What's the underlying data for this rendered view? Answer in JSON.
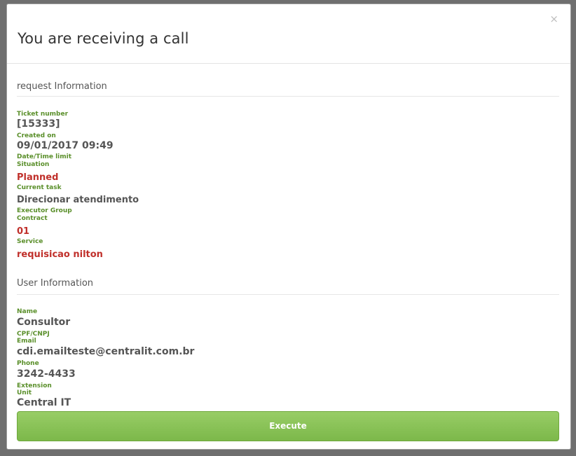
{
  "modal": {
    "title": "You are receiving a call",
    "close_label": "×"
  },
  "request_info": {
    "heading": "request Information",
    "ticket_number_label": "Ticket number",
    "ticket_number": "[15333]",
    "created_on_label": "Created on",
    "created_on": "09/01/2017 09:49",
    "date_time_limit_label": "Date/Time limit",
    "situation_label": "Situation",
    "situation": "Planned",
    "current_task_label": "Current task",
    "current_task": "Direcionar atendimento",
    "executor_group_label": "Executor Group",
    "contract_label": "Contract",
    "contract": "01",
    "service_label": "Service",
    "service": "requisicao nilton"
  },
  "user_info": {
    "heading": "User Information",
    "name_label": "Name",
    "name": "Consultor",
    "cpf_label": "CPF/CNPJ",
    "email_label": "Email",
    "email": "cdi.emailteste@centralit.com.br",
    "phone_label": "Phone",
    "phone": "3242-4433",
    "extension_label": "Extension",
    "unit_label": "Unit",
    "unit": "Central IT"
  },
  "actions": {
    "execute_label": "Execute"
  },
  "colors": {
    "label_green": "#5a8f2a",
    "value_red": "#c0302b",
    "button_green": "#8cc45a"
  }
}
